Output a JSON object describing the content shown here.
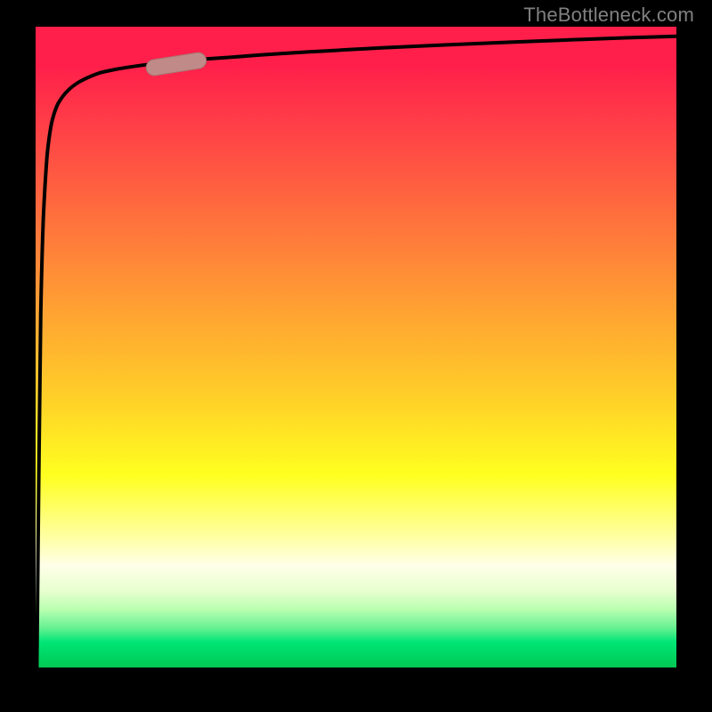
{
  "watermark": "TheBottleneck.com",
  "colors": {
    "curve": "#000000",
    "marker_fill": "#c08a88",
    "marker_stroke": "#a87270",
    "gradient_top": "#ff1f4a",
    "gradient_mid": "#ffff20",
    "gradient_bottom": "#00c853",
    "background": "#000000"
  },
  "chart_data": {
    "type": "line",
    "title": "",
    "xlabel": "",
    "ylabel": "",
    "xlim": [
      0,
      100
    ],
    "ylim": [
      0,
      100
    ],
    "series": [
      {
        "name": "bottleneck-curve",
        "x": [
          0.2,
          0.5,
          0.8,
          1.2,
          1.8,
          2.5,
          3.5,
          5,
          7,
          10,
          14,
          20,
          30,
          45,
          65,
          85,
          100
        ],
        "y": [
          0,
          30,
          55,
          70,
          80,
          85,
          88,
          90,
          91.5,
          92.8,
          93.6,
          94.4,
          95.2,
          96.2,
          97.2,
          98.0,
          98.5
        ]
      }
    ],
    "marker": {
      "name": "current-position",
      "x_range": [
        18,
        26
      ],
      "y_range": [
        93.8,
        94.8
      ]
    },
    "background_gradient": {
      "orientation": "vertical",
      "stops": [
        {
          "y": 100,
          "color": "#ff1f4a"
        },
        {
          "y": 40,
          "color": "#ffff20"
        },
        {
          "y": 10,
          "color": "#ffffe8"
        },
        {
          "y": 0,
          "color": "#00c853"
        }
      ]
    }
  }
}
